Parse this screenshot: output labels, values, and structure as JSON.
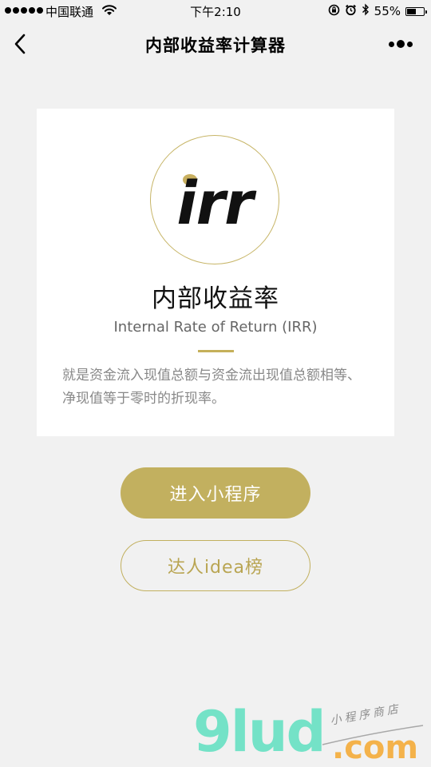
{
  "status_bar": {
    "carrier": "中国联通",
    "time": "下午2:10",
    "battery_percent": "55%",
    "battery_level": 0.55,
    "icons": [
      "signal-dots-icon",
      "wifi-icon",
      "orientation-lock-icon",
      "alarm-icon",
      "bluetooth-icon",
      "battery-icon"
    ]
  },
  "nav": {
    "title": "内部收益率计算器",
    "back_icon": "chevron-left-icon",
    "more_icon": "more-dots-icon"
  },
  "card": {
    "logo_text": "irr",
    "title": "内部收益率",
    "subtitle": "Internal Rate of Return (IRR)",
    "description": "就是资金流入现值总额与资金流出现值总额相等、净现值等于零时的折现率。"
  },
  "buttons": {
    "enter": "进入小程序",
    "ranking": "达人idea榜"
  },
  "watermark": {
    "main": "9lud",
    "domain": ".com",
    "tagline": "小程序商店"
  },
  "colors": {
    "background": "#f1f1f1",
    "card": "#ffffff",
    "gold": "#c2b05f",
    "watermark_green": "#74e2c7",
    "watermark_orange": "#f4b24a"
  }
}
